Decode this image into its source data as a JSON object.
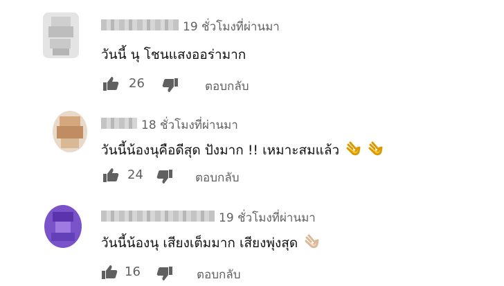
{
  "comments": [
    {
      "time": "19 ชั่วโมงที่ผ่านมา",
      "text": "วันนี้ นุ  โชนแสงออร่ามาก",
      "likes": "26",
      "reply": "ตอบกลับ",
      "avatar_color": "#d6d6d6"
    },
    {
      "time": "18 ชั่วโมงที่ผ่านมา",
      "text": "วันนี้น้องนุคือดีสุด ปังมาก !! เหมาะสมแล้ว",
      "likes": "24",
      "reply": "ตอบกลับ",
      "emoji": "clapping-hands x2",
      "avatar_color": "#c89a74"
    },
    {
      "time": "19 ชั่วโมงที่ผ่านมา",
      "text": "วันนี้น้องนุ เสียงเต็มมาก เสียงพุ่งสุด",
      "likes": "16",
      "reply": "ตอบกลับ",
      "emoji": "clapping-hands",
      "avatar_color": "#6a3fbf"
    }
  ]
}
